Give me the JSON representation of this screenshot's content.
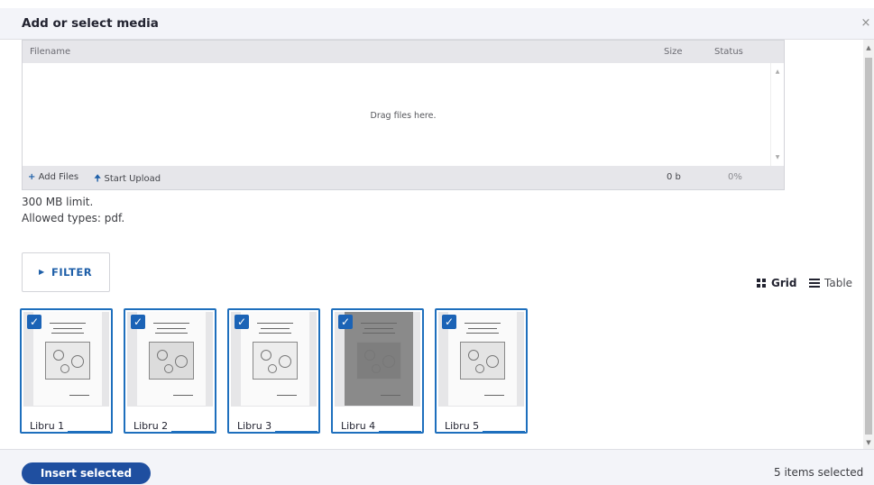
{
  "dialog": {
    "title": "Add or select media",
    "close_glyph": "×"
  },
  "uploader": {
    "columns": {
      "filename": "Filename",
      "size": "Size",
      "status": "Status"
    },
    "drop_text": "Drag files here.",
    "add_files_label": "Add Files",
    "start_upload_label": "Start Upload",
    "total_size": "0 b",
    "total_status": "0%"
  },
  "info": {
    "limit": "300 MB limit.",
    "allowed_types": "Allowed types: pdf."
  },
  "filter": {
    "label": "FILTER"
  },
  "views": {
    "grid_label": "Grid",
    "table_label": "Table",
    "active": "grid"
  },
  "media_items": [
    {
      "label": "Libru 1",
      "selected": true
    },
    {
      "label": "Libru 2",
      "selected": true
    },
    {
      "label": "Libru 3",
      "selected": true
    },
    {
      "label": "Libru 4",
      "selected": true
    },
    {
      "label": "Libru 5",
      "selected": true
    }
  ],
  "footer": {
    "insert_label": "Insert selected",
    "selected_count": "5 items selected"
  },
  "colors": {
    "accent": "#1e6fbd",
    "insert_button": "#1f4fa0"
  }
}
